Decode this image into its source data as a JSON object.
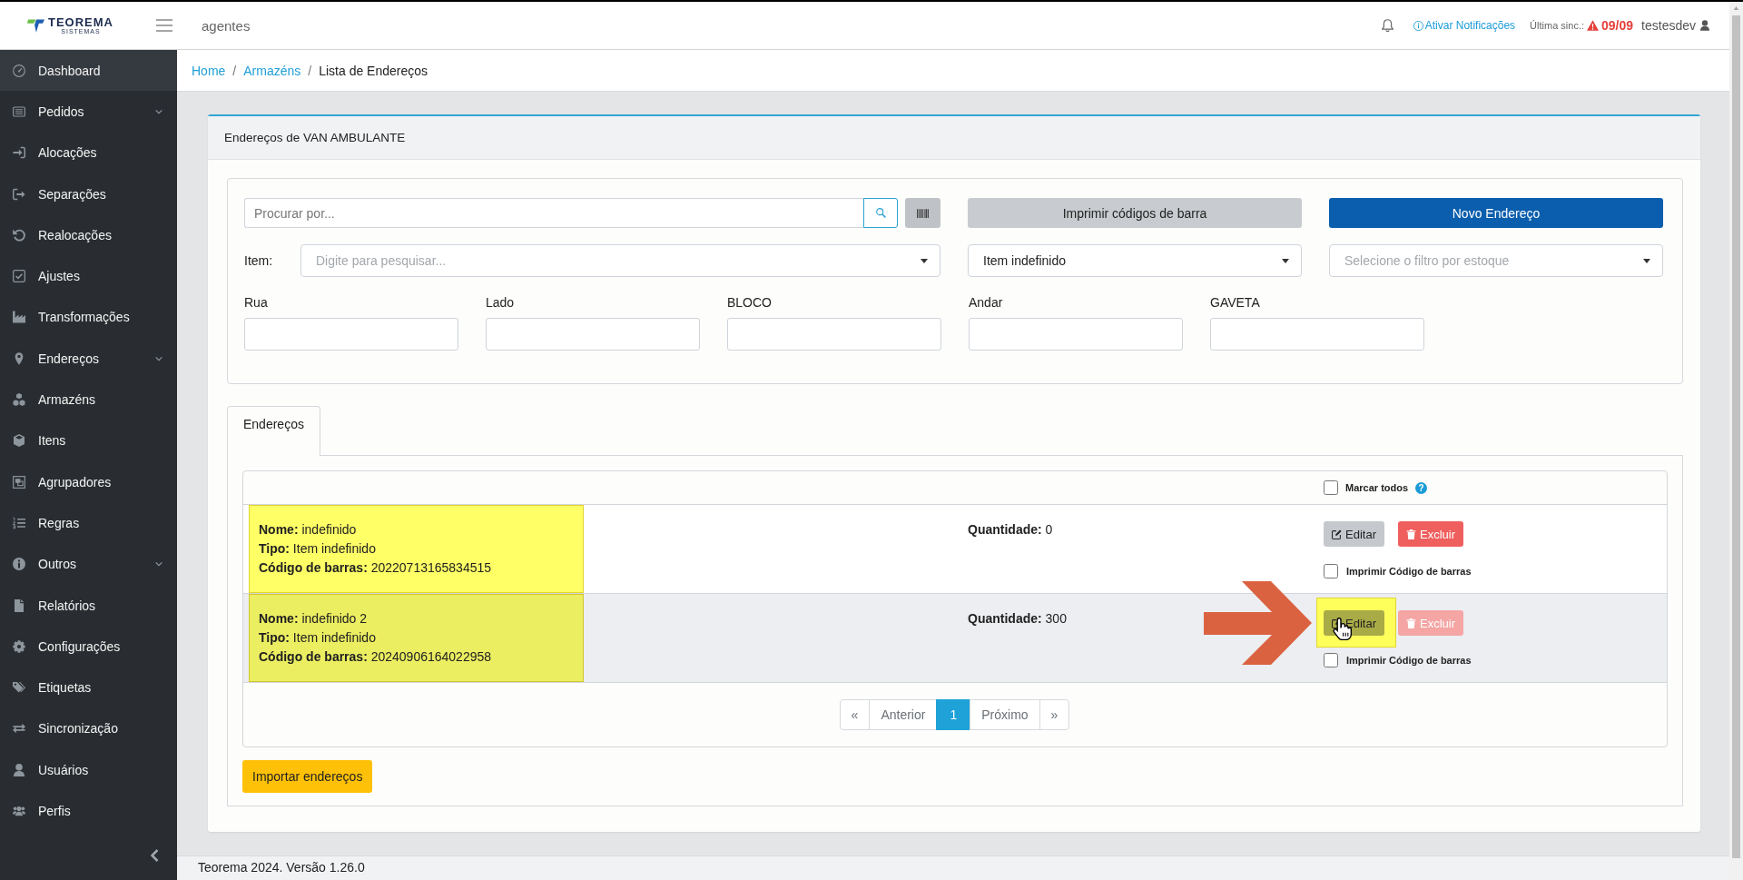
{
  "header": {
    "logo": {
      "name": "TEOREMA",
      "tagline": "SISTEMAS"
    },
    "context": "agentes",
    "notifications_link": "Ativar Notificações",
    "sync": {
      "label": "Última sinc.:",
      "value": "09/09",
      "warning": true
    },
    "user": "testesdev"
  },
  "sidebar": {
    "items": [
      {
        "label": "Dashboard",
        "selected": true,
        "submenu": false
      },
      {
        "label": "Pedidos",
        "selected": false,
        "submenu": true
      },
      {
        "label": "Alocações",
        "selected": false,
        "submenu": false
      },
      {
        "label": "Separações",
        "selected": false,
        "submenu": false
      },
      {
        "label": "Realocações",
        "selected": false,
        "submenu": false
      },
      {
        "label": "Ajustes",
        "selected": false,
        "submenu": false
      },
      {
        "label": "Transformações",
        "selected": false,
        "submenu": false
      },
      {
        "label": "Endereços",
        "selected": false,
        "submenu": true
      },
      {
        "label": "Armazéns",
        "selected": false,
        "submenu": false
      },
      {
        "label": "Itens",
        "selected": false,
        "submenu": false
      },
      {
        "label": "Agrupadores",
        "selected": false,
        "submenu": false
      },
      {
        "label": "Regras",
        "selected": false,
        "submenu": false
      },
      {
        "label": "Outros",
        "selected": false,
        "submenu": true
      },
      {
        "label": "Relatórios",
        "selected": false,
        "submenu": false
      },
      {
        "label": "Configurações",
        "selected": false,
        "submenu": false
      },
      {
        "label": "Etiquetas",
        "selected": false,
        "submenu": false
      },
      {
        "label": "Sincronização",
        "selected": false,
        "submenu": false
      },
      {
        "label": "Usuários",
        "selected": false,
        "submenu": false
      },
      {
        "label": "Perfis",
        "selected": false,
        "submenu": false
      }
    ]
  },
  "breadcrumb": {
    "separator": "/",
    "items": [
      {
        "label": "Home",
        "link": true
      },
      {
        "label": "Armazéns",
        "link": true
      },
      {
        "label": "Lista de Endereços",
        "link": false
      }
    ]
  },
  "card": {
    "title": "Endereços de VAN AMBULANTE",
    "filters": {
      "search": {
        "placeholder": "Procurar por..."
      },
      "print_button": "Imprimir códigos de barra",
      "new_button": "Novo Endereço",
      "item_label": "Item:",
      "item_select": {
        "placeholder": "Digite para pesquisar..."
      },
      "type_select": {
        "value": "Item indefinido"
      },
      "stock_select": {
        "placeholder": "Selecione o filtro por estoque"
      },
      "fields": [
        {
          "label": "Rua"
        },
        {
          "label": "Lado"
        },
        {
          "label": "BLOCO"
        },
        {
          "label": "Andar"
        },
        {
          "label": "GAVETA"
        }
      ]
    },
    "tabs": [
      {
        "label": "Endereços",
        "selected": true
      }
    ],
    "table": {
      "select_all": {
        "label": "Marcar todos",
        "checked": false,
        "help": "?"
      },
      "rows": [
        {
          "name": "**Nome:** indefinido",
          "type": "**Tipo:** Item indefinido",
          "barcode": "**Código de barras:** 20220713165834515",
          "quantity": "**Quantidade:** 0",
          "highlighted": true,
          "hovered": false,
          "edit_button": {
            "label": "Editar",
            "highlighted": false,
            "cursor": false
          },
          "delete_button": {
            "label": "Excluir",
            "disabled": false
          },
          "print_barcode": {
            "label": "Imprimir Código de barras",
            "checked": false
          },
          "arrow_callout": false
        },
        {
          "name": "**Nome:** indefinido 2",
          "type": "**Tipo:** Item indefinido",
          "barcode": "**Código de barras:** 20240906164022958",
          "quantity": "**Quantidade:** 300",
          "highlighted": true,
          "hovered": true,
          "edit_button": {
            "label": "Editar",
            "highlighted": true,
            "cursor": true
          },
          "delete_button": {
            "label": "Excluir",
            "disabled": true
          },
          "print_barcode": {
            "label": "Imprimir Código de barras",
            "checked": false
          },
          "arrow_callout": true
        }
      ]
    },
    "pagination": [
      {
        "label": "«",
        "selected": false
      },
      {
        "label": "Anterior",
        "selected": false
      },
      {
        "label": "1",
        "selected": true
      },
      {
        "label": "Próximo",
        "selected": false
      },
      {
        "label": "»",
        "selected": false
      }
    ],
    "import_button": "Importar endereços"
  },
  "footer": "Teorema 2024. Versão 1.26.0"
}
